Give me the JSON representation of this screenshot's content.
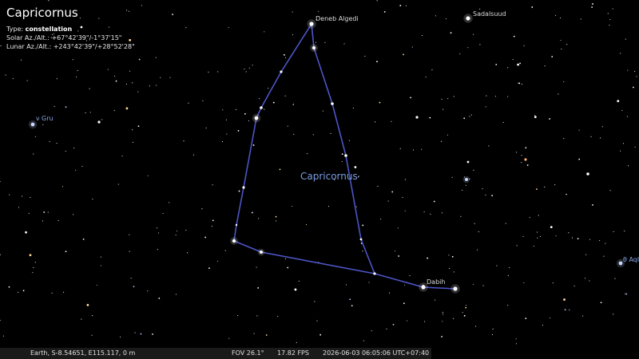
{
  "info": {
    "title": "Capricornus",
    "type_label": "Type:",
    "type_value": "constellation",
    "solar": "Solar Az./Alt.: +67°42'39\"/-1°37'15\"",
    "lunar": "Lunar Az./Alt.: +243°42'39\"/+28°52'28\""
  },
  "labels": {
    "constellation": "Capricornus",
    "deneb_algedi": "Deneb Algedi",
    "sadalsuud": "Sadalsuud",
    "nu_gru": "ν Gru",
    "dabih": "Dabih",
    "theta_aql": "θ Aql"
  },
  "status": {
    "location": "Earth, S-8.54651, E115.117, 0 m",
    "fov": "FOV 26.1°",
    "fps": "17.82 FPS",
    "datetime": "2026-06-03 06:05:06 UTC+07:40"
  },
  "colors": {
    "background": "#000000",
    "constellation_line": "#4d55c8",
    "constellation_label": "#7a9be0",
    "star_label": "#dcdcdc",
    "blue_label": "#8aa8e8"
  }
}
